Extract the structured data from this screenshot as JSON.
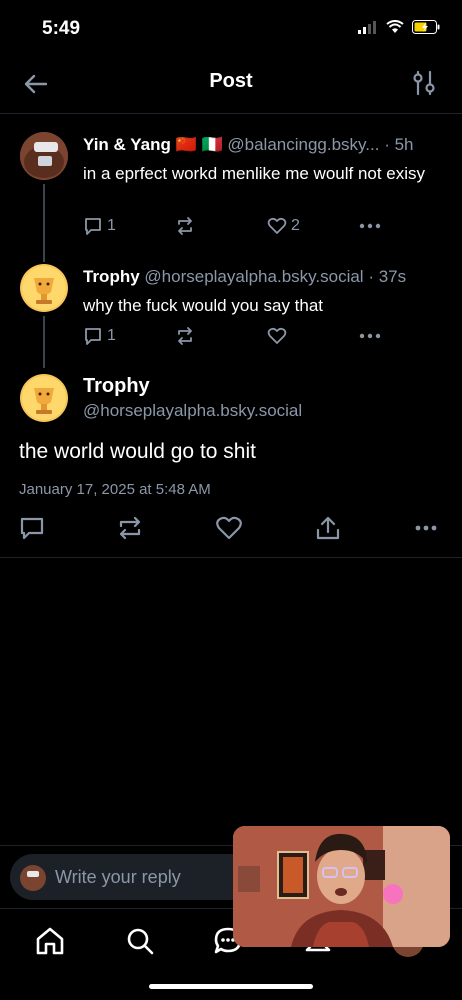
{
  "status": {
    "time": "5:49"
  },
  "header": {
    "title": "Post"
  },
  "thread": [
    {
      "name": "Yin & Yang",
      "flags": "🇨🇳 🇮🇹",
      "handle": "@balancingg.bsky...",
      "time": "· 5h",
      "text": "in a eprfect workd menlike me woulf not exisy",
      "reply_count": "1",
      "like_count": "2"
    },
    {
      "name": "Trophy",
      "handle": "@horseplayalpha.bsky.social",
      "time": "· 37s",
      "text": "why the fuck would you say that",
      "reply_count": "1",
      "like_count": ""
    }
  ],
  "main_post": {
    "name": "Trophy",
    "handle": "@horseplayalpha.bsky.social",
    "text": "the world would go to shit",
    "date": "January 17, 2025 at 5:48 AM"
  },
  "reply": {
    "placeholder": "Write your reply"
  },
  "colors": {
    "accent": "#8b97a8",
    "background": "#000000",
    "divider": "#1e232b"
  },
  "icons": {
    "tabs": [
      "home-icon",
      "search-icon",
      "chat-icon",
      "notifications-icon",
      "profile-avatar"
    ]
  }
}
